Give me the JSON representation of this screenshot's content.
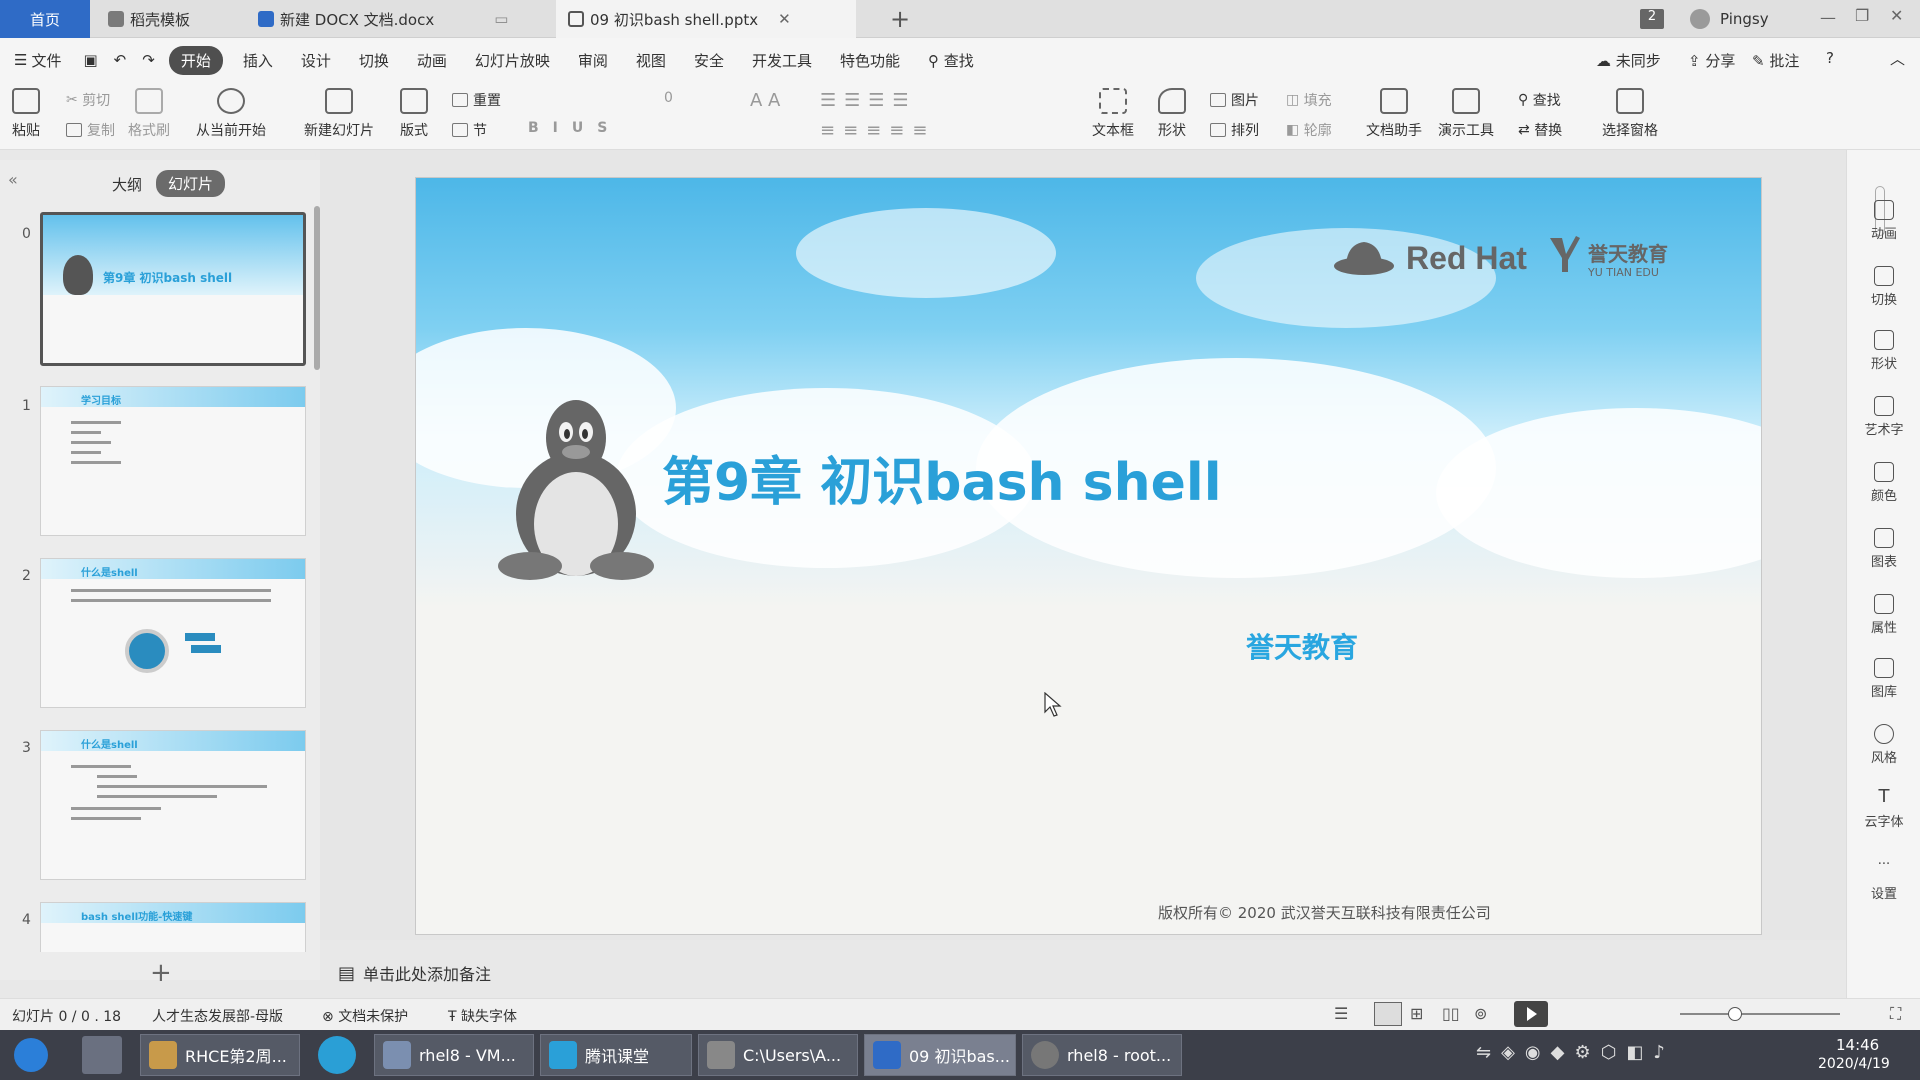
{
  "tabs": {
    "home": "首页",
    "t1": "稻壳模板",
    "t2": "新建 DOCX 文档.docx",
    "t3": "09 初识bash shell.pptx",
    "badge": "2",
    "user": "Pingsy"
  },
  "menu": [
    "文件",
    "开始",
    "插入",
    "设计",
    "切换",
    "动画",
    "幻灯片放映",
    "审阅",
    "视图",
    "安全",
    "开发工具",
    "特色功能",
    "查找"
  ],
  "menu_right": {
    "sync": "未同步",
    "share": "分享",
    "comment": "批注"
  },
  "ribbon": {
    "paste": "粘贴",
    "cut": "剪切",
    "copy": "复制",
    "format_painter": "格式刷",
    "from_start": "从当前开始",
    "new_slide": "新建幻灯片",
    "layout": "版式",
    "reset": "重置",
    "section": "节",
    "font_size": "0",
    "textbox": "文本框",
    "shape": "形状",
    "picture": "图片",
    "fill": "填充",
    "arrange": "排列",
    "outline": "轮廓",
    "doc_helper": "文档助手",
    "present_tools": "演示工具",
    "find": "查找",
    "replace": "替换",
    "select_pane": "选择窗格"
  },
  "left": {
    "outline_tab": "大纲",
    "slides_tab": "幻灯片"
  },
  "thumbs": [
    {
      "num": "0",
      "title": "第9章 初识bash shell"
    },
    {
      "num": "1",
      "title": "学习目标"
    },
    {
      "num": "2",
      "title": "什么是shell"
    },
    {
      "num": "3",
      "title": "什么是shell"
    },
    {
      "num": "4",
      "title": "bash shell功能-快速键"
    }
  ],
  "slide": {
    "redhat": "Red Hat",
    "brand_cn": "誉天教育",
    "brand_en": "YU TIAN EDU",
    "title": "第9章  初识bash shell",
    "org": "誉天教育",
    "copyright": "版权所有© 2020 武汉誉天互联科技有限责任公司"
  },
  "rightbar": [
    "动画",
    "切换",
    "形状",
    "艺术字",
    "颜色",
    "图表",
    "属性",
    "图库",
    "风格",
    "云字体",
    "设置"
  ],
  "notes": "单击此处添加备注",
  "status": {
    "slide": "幻灯片 0 / 0 . 18",
    "master": "人才生态发展部-母版",
    "protect": "文档未保护",
    "font": "缺失字体"
  },
  "taskbar": {
    "t1": "RHCE第2周...",
    "t2": "rhel8 - VM...",
    "t3": "腾讯课堂",
    "t4": "C:\\Users\\A...",
    "t5": "09 初识bas...",
    "t6": "rhel8 - root...",
    "time": "14:46",
    "date": "2020/4/19"
  },
  "colors": {
    "accent": "#2f6bc6",
    "slide_title": "#2aa0d8",
    "org": "#29a6e0"
  }
}
